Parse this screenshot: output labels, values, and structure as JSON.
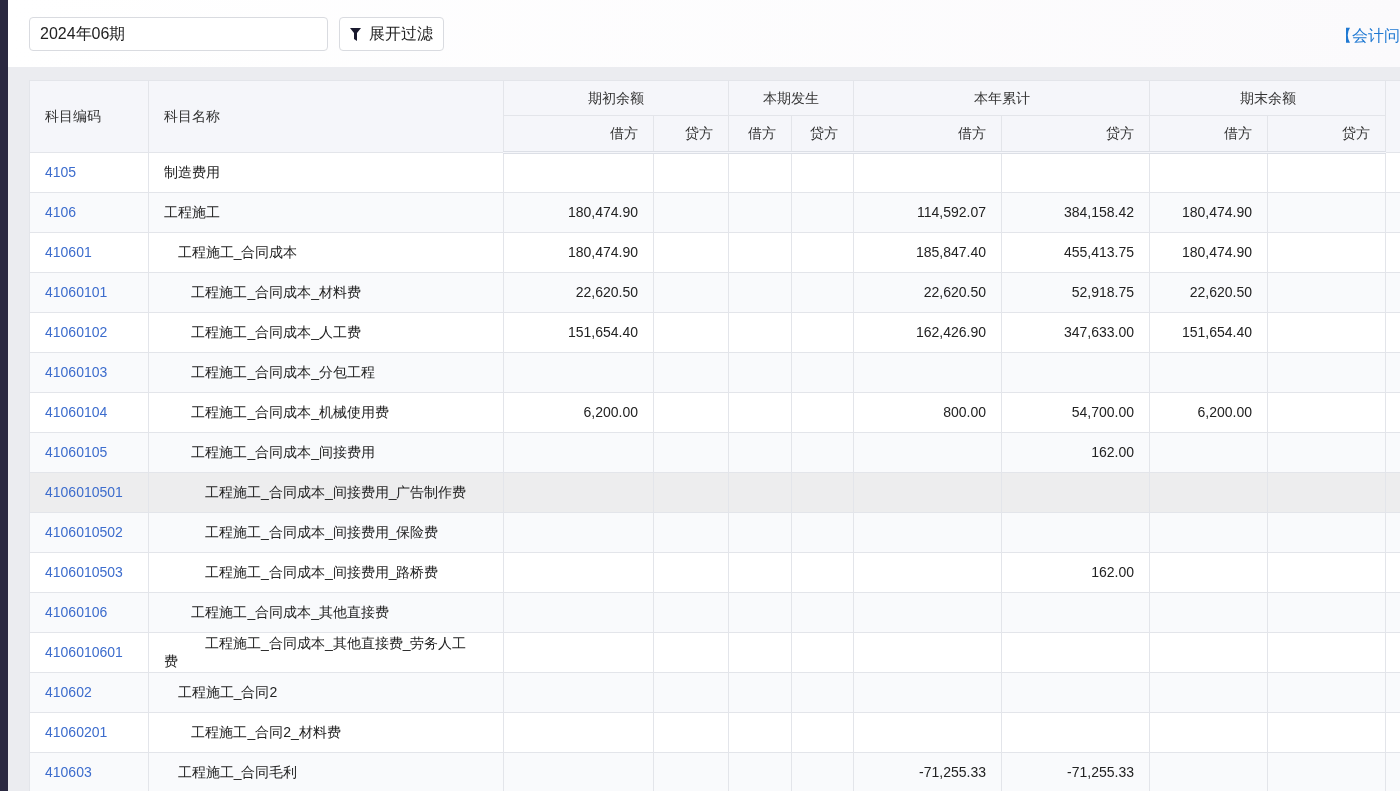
{
  "period_field": {
    "value": "2024年06期"
  },
  "filter_button": {
    "label": "展开过滤"
  },
  "help_link": {
    "label": "【会计问"
  },
  "table": {
    "columns": [
      {
        "label": "科目编码"
      },
      {
        "label": "科目名称"
      }
    ],
    "groups": [
      {
        "label": "期初余额",
        "sub": [
          "借方",
          "贷方"
        ]
      },
      {
        "label": "本期发生",
        "sub": [
          "借方",
          "贷方"
        ]
      },
      {
        "label": "本年累计",
        "sub": [
          "借方",
          "贷方"
        ]
      },
      {
        "label": "期末余额",
        "sub": [
          "借方",
          "贷方"
        ]
      }
    ],
    "rows": [
      {
        "code": "4105",
        "name": "制造费用",
        "hovered": false
      },
      {
        "code": "4106",
        "name": "工程施工",
        "hovered": false,
        "amounts": {
          "opening_debit": "180,474.90",
          "ytd_debit": "114,592.07",
          "ytd_credit": "384,158.42",
          "closing_debit": "180,474.90"
        },
        "children": [
          {
            "code": "410601",
            "name": "工程施工_合同成本",
            "hovered": false,
            "amounts": {
              "opening_debit": "180,474.90",
              "ytd_debit": "185,847.40",
              "ytd_credit": "455,413.75",
              "closing_debit": "180,474.90"
            },
            "children": [
              {
                "code": "41060101",
                "name": "工程施工_合同成本_材料费",
                "hovered": false,
                "amounts": {
                  "opening_debit": "22,620.50",
                  "ytd_debit": "22,620.50",
                  "ytd_credit": "52,918.75",
                  "closing_debit": "22,620.50"
                }
              },
              {
                "code": "41060102",
                "name": "工程施工_合同成本_人工费",
                "hovered": false,
                "amounts": {
                  "opening_debit": "151,654.40",
                  "ytd_debit": "162,426.90",
                  "ytd_credit": "347,633.00",
                  "closing_debit": "151,654.40"
                }
              },
              {
                "code": "41060103",
                "name": "工程施工_合同成本_分包工程",
                "hovered": false
              },
              {
                "code": "41060104",
                "name": "工程施工_合同成本_机械使用费",
                "hovered": false,
                "amounts": {
                  "opening_debit": "6,200.00",
                  "ytd_debit": "800.00",
                  "ytd_credit": "54,700.00",
                  "closing_debit": "6,200.00"
                }
              },
              {
                "code": "41060105",
                "name": "工程施工_合同成本_间接费用",
                "hovered": false,
                "amounts": {
                  "ytd_credit": "162.00"
                },
                "children": [
                  {
                    "code": "4106010501",
                    "name": "工程施工_合同成本_间接费用_广告制作费",
                    "hovered": true
                  },
                  {
                    "code": "4106010502",
                    "name": "工程施工_合同成本_间接费用_保险费",
                    "hovered": false
                  },
                  {
                    "code": "4106010503",
                    "name": "工程施工_合同成本_间接费用_路桥费",
                    "hovered": false,
                    "amounts": {
                      "ytd_credit": "162.00"
                    }
                  }
                ]
              },
              {
                "code": "41060106",
                "name": "工程施工_合同成本_其他直接费",
                "hovered": false,
                "children": [
                  {
                    "code": "4106010601",
                    "name": "工程施工_合同成本_其他直接费_劳务人工费",
                    "hovered": false
                  }
                ]
              }
            ]
          },
          {
            "code": "410602",
            "name": "工程施工_合同2",
            "hovered": false,
            "children": [
              {
                "code": "41060201",
                "name": "工程施工_合同2_材料费",
                "hovered": false
              }
            ]
          },
          {
            "code": "410603",
            "name": "工程施工_合同毛利",
            "hovered": false,
            "amounts": {
              "ytd_debit": "-71,255.33",
              "ytd_credit": "-71,255.33"
            }
          }
        ]
      }
    ]
  }
}
